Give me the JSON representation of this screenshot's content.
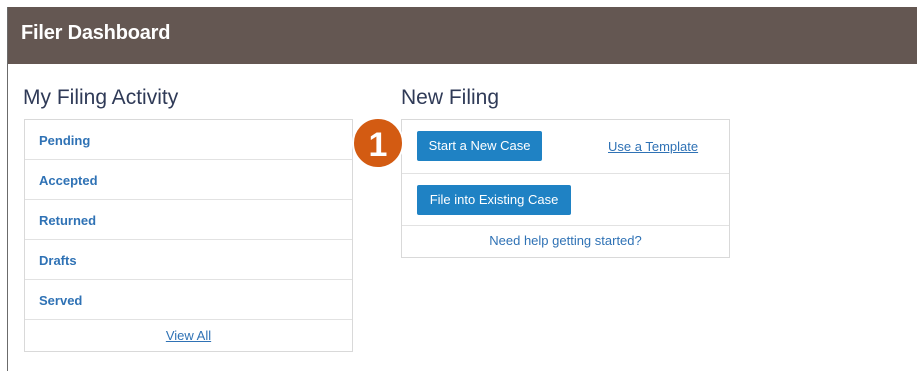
{
  "header": {
    "title": "Filer Dashboard",
    "background_color": "#645752"
  },
  "activity": {
    "title": "My Filing Activity",
    "items": [
      {
        "label": "Pending"
      },
      {
        "label": "Accepted"
      },
      {
        "label": "Returned"
      },
      {
        "label": "Drafts"
      },
      {
        "label": "Served"
      }
    ],
    "view_all_label": "View All"
  },
  "new_filing": {
    "title": "New Filing",
    "start_case_label": "Start a New Case",
    "use_template_label": "Use a Template",
    "file_existing_label": "File into Existing Case",
    "help_label": "Need help getting started?"
  },
  "callout": {
    "number": "1",
    "color": "#d35b12"
  },
  "colors": {
    "link": "#2f72b5",
    "button": "#1f82c4",
    "heading": "#2f3a57"
  }
}
